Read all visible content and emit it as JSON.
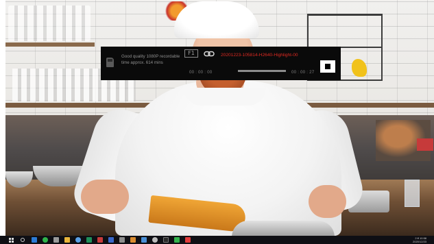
{
  "overlay": {
    "quality_text": "Good quality 1080P recordable time approx. 614 mins",
    "hotkey": "F1",
    "filename": "20201223-105814-H2640-Highlight-00",
    "time_start": "00 : 00 : 00",
    "time_end": "00 : 00 : 27",
    "progress": 1.0,
    "colors": {
      "background": "#0a0a0a",
      "filename": "#e02a22"
    },
    "icons": [
      "storage-card-icon",
      "link-icon",
      "stop-icon"
    ]
  },
  "taskbar": {
    "clock_time": "2:ff 10:58",
    "clock_date": "2020/12/23",
    "icons": [
      "windows-start-icon",
      "search-icon",
      "browser-icon",
      "chat-icon",
      "file-explorer-icon",
      "chrome-icon",
      "mail-icon",
      "app-icon",
      "photo-icon",
      "settings-icon",
      "app-icon",
      "app-icon",
      "recorder-icon"
    ]
  }
}
